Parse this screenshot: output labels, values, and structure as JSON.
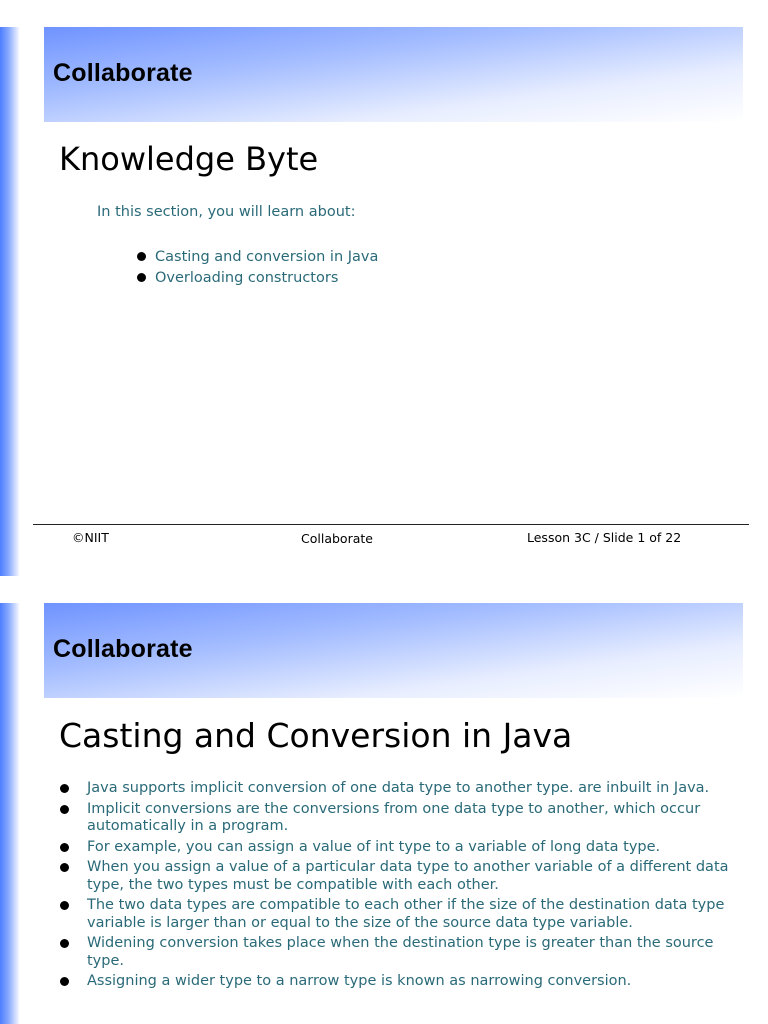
{
  "slide1": {
    "header_title": "Collaborate",
    "heading": "Knowledge Byte",
    "intro": "In this section, you will learn about:",
    "topics": [
      "Casting and conversion in Java",
      "Overloading constructors"
    ],
    "footer": {
      "copyright": "©NIIT",
      "center": "Collaborate",
      "slide_info": "Lesson 3C / Slide 1 of 22"
    }
  },
  "slide2": {
    "header_title": "Collaborate",
    "heading": "Casting and Conversion in Java",
    "bullets": [
      "Java supports implicit conversion of one data type to another type. are inbuilt in Java.",
      "Implicit conversions are the conversions from one data type to another, which occur automatically in a program.",
      "For example, you can assign a value of int type to a variable of long data type.",
      "When you assign a value of a particular data type to another variable of a different data type, the two types must be compatible with each other.",
      "The two data types are compatible to each other if the size of the destination data type variable is larger than or equal to the size of the source data type variable.",
      "Widening conversion takes place when the destination type is greater than the source type.",
      "Assigning a wider type to a narrow type is known as narrowing conversion."
    ]
  },
  "colors": {
    "text_teal": "#2a6a78",
    "header_blue": "#6f93ff"
  }
}
